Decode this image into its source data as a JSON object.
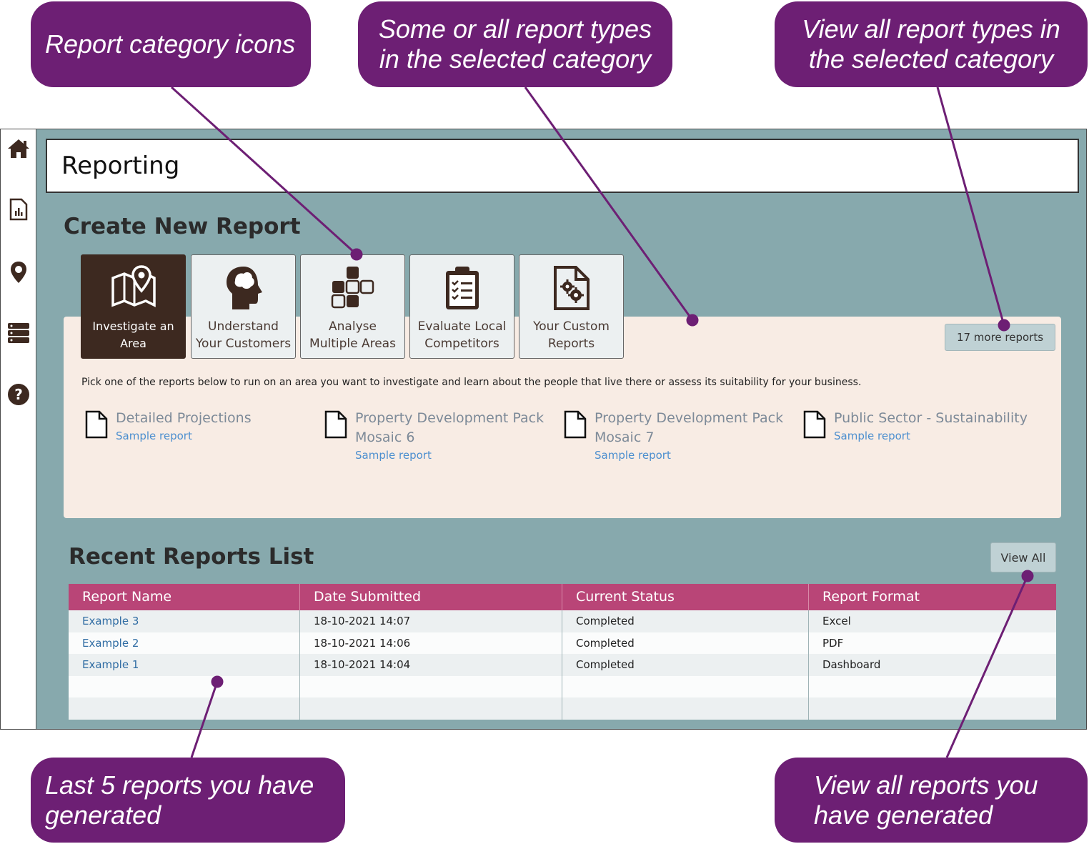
{
  "callouts": {
    "icons": "Report category icons",
    "some_reports": "Some or all report types in the selected category",
    "view_all_types": "View all report types in the selected category",
    "last_five": "Last 5 reports you have generated",
    "view_all_reports": "View all reports you have generated"
  },
  "sidebar": {
    "items": [
      {
        "icon": "home-icon"
      },
      {
        "icon": "report-icon"
      },
      {
        "icon": "map-pin-icon"
      },
      {
        "icon": "database-icon"
      },
      {
        "icon": "help-icon"
      }
    ]
  },
  "header": {
    "title": "Reporting"
  },
  "create": {
    "title": "Create New Report",
    "categories": [
      {
        "label": "Investigate an Area",
        "icon": "map-pin-area-icon",
        "active": true
      },
      {
        "label": "Understand Your Customers",
        "icon": "head-icon",
        "active": false
      },
      {
        "label": "Analyse Multiple Areas",
        "icon": "blocks-icon",
        "active": false
      },
      {
        "label": "Evaluate Local Competitors",
        "icon": "clipboard-icon",
        "active": false
      },
      {
        "label": "Your Custom Reports",
        "icon": "gear-document-icon",
        "active": false
      }
    ],
    "more_reports": "17 more reports",
    "description": "Pick one of the reports below to run on an area you want to investigate and learn about the people that live there or assess its suitability for your business.",
    "reports": [
      {
        "name": "Detailed Projections",
        "sample": "Sample report"
      },
      {
        "name": "Property Development Pack Mosaic 6",
        "sample": "Sample report"
      },
      {
        "name": "Property Development Pack Mosaic 7",
        "sample": "Sample report"
      },
      {
        "name": "Public Sector - Sustainability",
        "sample": "Sample report"
      }
    ]
  },
  "recent": {
    "title": "Recent Reports List",
    "view_all": "View All",
    "columns": [
      "Report Name",
      "Date Submitted",
      "Current Status",
      "Report Format"
    ],
    "rows": [
      [
        "Example 3",
        "18-10-2021 14:07",
        "Completed",
        "Excel"
      ],
      [
        "Example 2",
        "18-10-2021 14:06",
        "Completed",
        "PDF"
      ],
      [
        "Example 1",
        "18-10-2021 14:04",
        "Completed",
        "Dashboard"
      ],
      [
        "",
        "",
        "",
        ""
      ],
      [
        "",
        "",
        "",
        ""
      ]
    ]
  },
  "colors": {
    "callout": "#6d1f74",
    "background": "#87a9ad",
    "active_tile": "#3d2920",
    "table_header": "#b94577",
    "link": "#2f6ca3"
  }
}
